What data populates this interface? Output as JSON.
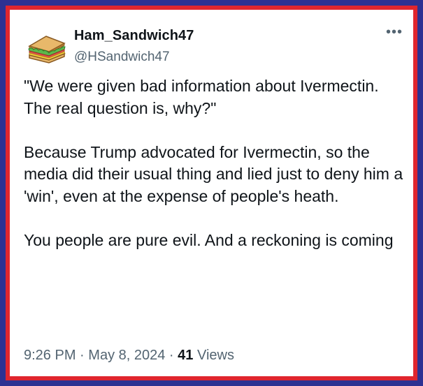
{
  "author": {
    "display_name": "Ham_Sandwich47",
    "handle": "@HSandwich47",
    "avatar_icon": "sandwich-icon"
  },
  "more_label": "•••",
  "tweet": {
    "paragraphs": [
      "\"We were given bad information about Ivermectin. The real question is, why?\"",
      "Because Trump advocated for Ivermectin, so the media did their usual thing and lied just to deny him a 'win', even at the expense of people's heath.",
      "You people are pure evil. And a reckoning is coming"
    ]
  },
  "meta": {
    "time": "9:26 PM",
    "separator": "·",
    "date": "May 8, 2024",
    "views_count": "41",
    "views_label": "Views"
  },
  "colors": {
    "outer_border": "#2d3192",
    "inner_border": "#e0262e",
    "text_primary": "#0f1419",
    "text_secondary": "#536471"
  }
}
